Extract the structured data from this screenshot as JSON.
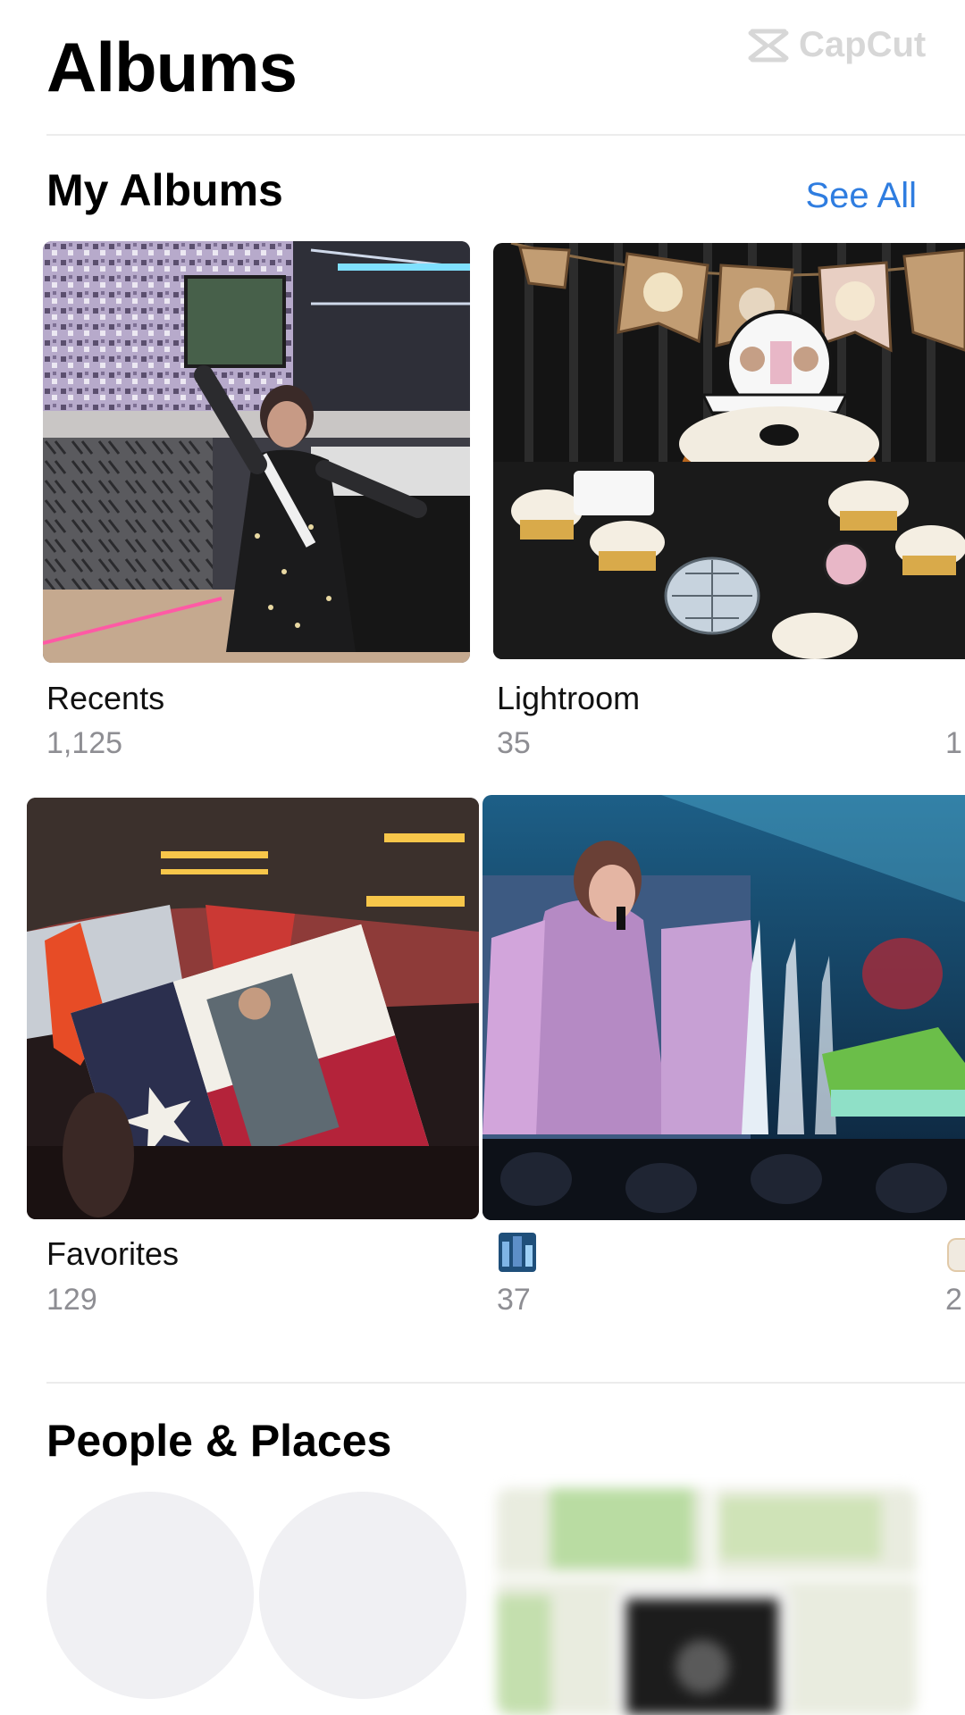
{
  "page": {
    "title": "Albums"
  },
  "watermark": {
    "text": "CapCut"
  },
  "my_albums": {
    "section_title": "My Albums",
    "see_all_label": "See All",
    "albums": [
      {
        "name": "Recents",
        "count": "1,125"
      },
      {
        "name": "Lightroom",
        "count": "35"
      },
      {
        "name": "Favorites",
        "count": "129"
      },
      {
        "name": "",
        "count": "37"
      }
    ],
    "cut_off_counts": [
      "1",
      "2"
    ]
  },
  "people_places": {
    "section_title": "People & Places"
  },
  "colors": {
    "accent": "#2f7de0",
    "secondary_text": "#8e8e93",
    "divider": "#ececec"
  }
}
